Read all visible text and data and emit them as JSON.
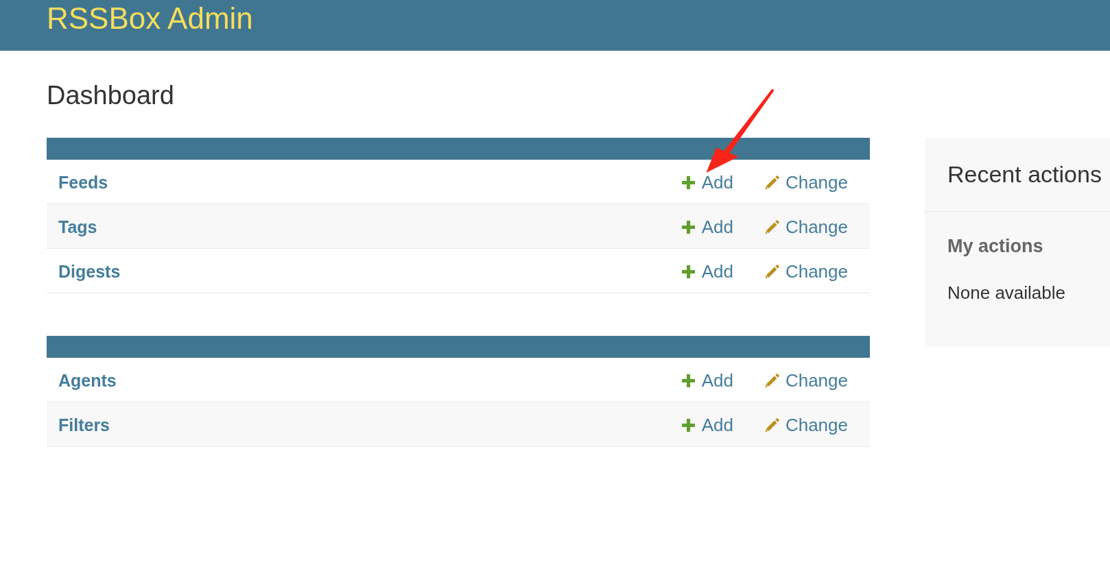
{
  "header": {
    "title": "RSSBox Admin"
  },
  "page_title": "Dashboard",
  "modules": [
    {
      "models": [
        {
          "name": "Feeds",
          "actions": [
            {
              "kind": "add",
              "label": "Add"
            },
            {
              "kind": "change",
              "label": "Change"
            }
          ]
        },
        {
          "name": "Tags",
          "actions": [
            {
              "kind": "add",
              "label": "Add"
            },
            {
              "kind": "change",
              "label": "Change"
            }
          ]
        },
        {
          "name": "Digests",
          "actions": [
            {
              "kind": "add",
              "label": "Add"
            },
            {
              "kind": "change",
              "label": "Change"
            }
          ]
        }
      ]
    },
    {
      "models": [
        {
          "name": "Agents",
          "actions": [
            {
              "kind": "add",
              "label": "Add"
            },
            {
              "kind": "change",
              "label": "Change"
            }
          ]
        },
        {
          "name": "Filters",
          "actions": [
            {
              "kind": "add",
              "label": "Add"
            },
            {
              "kind": "change",
              "label": "Change"
            }
          ]
        }
      ]
    }
  ],
  "recent_actions": {
    "title": "Recent actions",
    "subtitle": "My actions",
    "empty_text": "None available"
  }
}
